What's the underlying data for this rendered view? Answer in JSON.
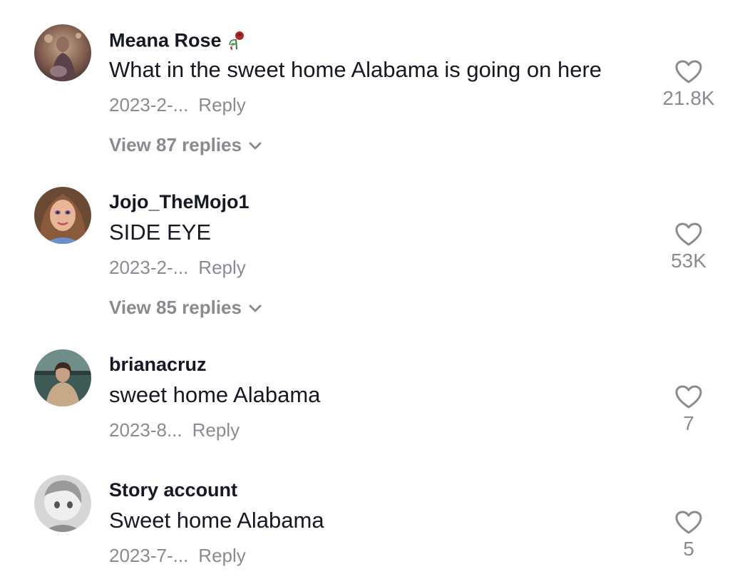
{
  "comments": [
    {
      "username": "Meana Rose",
      "username_emoji": "wilted-rose-icon",
      "text": "What in the sweet home Alabama is going on here",
      "date": "2023-2-...",
      "reply_label": "Reply",
      "likes": "21.8K",
      "view_replies": "View 87 replies"
    },
    {
      "username": "Jojo_TheMojo1",
      "text": "SIDE EYE",
      "date": "2023-2-...",
      "reply_label": "Reply",
      "likes": "53K",
      "view_replies": "View 85 replies"
    },
    {
      "username": "brianacruz",
      "text": "sweet home Alabama",
      "date": "2023-8...",
      "reply_label": "Reply",
      "likes": "7"
    },
    {
      "username": "Story account",
      "text": "Sweet home Alabama",
      "date": "2023-7-...",
      "reply_label": "Reply",
      "likes": "5"
    }
  ],
  "colors": {
    "primary_text": "#161823",
    "secondary_text": "#8a8b91",
    "background": "#ffffff"
  },
  "icons": {
    "like": "heart-outline-icon",
    "expand": "chevron-down-icon"
  }
}
